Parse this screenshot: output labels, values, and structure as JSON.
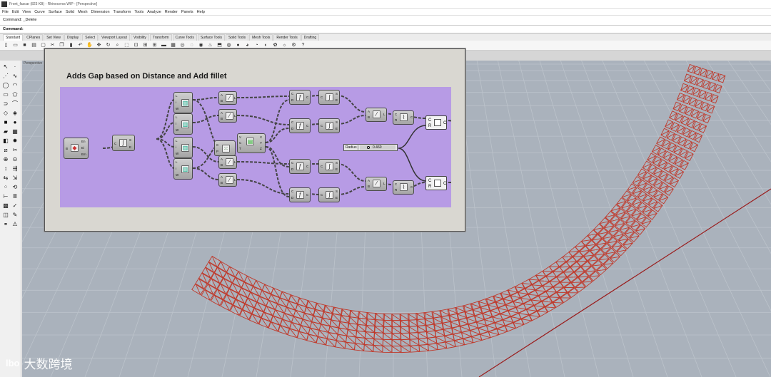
{
  "window": {
    "title": "Front_fascar (823 KB) - Rhinoceros WIP - [Perspective]"
  },
  "menu": [
    "File",
    "Edit",
    "View",
    "Curve",
    "Surface",
    "Solid",
    "Mesh",
    "Dimension",
    "Transform",
    "Tools",
    "Analyze",
    "Render",
    "Panels",
    "Help"
  ],
  "command": {
    "history": "Command: _Delete",
    "prompt": "Command:"
  },
  "tabs": [
    "Standard",
    "CPlanes",
    "Set View",
    "Display",
    "Select",
    "Viewport Layout",
    "Visibility",
    "Transform",
    "Curve Tools",
    "Surface Tools",
    "Solid Tools",
    "Mesh Tools",
    "Render Tools",
    "Drafting"
  ],
  "viewport": {
    "label": "Perspective"
  },
  "grasshopper": {
    "group_title": "Adds Gap based on Distance and Add fillet",
    "slider": {
      "label": "Radius",
      "value": "0.460"
    }
  },
  "watermark": {
    "logo": "lbo",
    "text": "大数跨境"
  },
  "colors": {
    "group": "#b79be5",
    "grid": "#aeb6bf",
    "curve": "#c0392b"
  }
}
